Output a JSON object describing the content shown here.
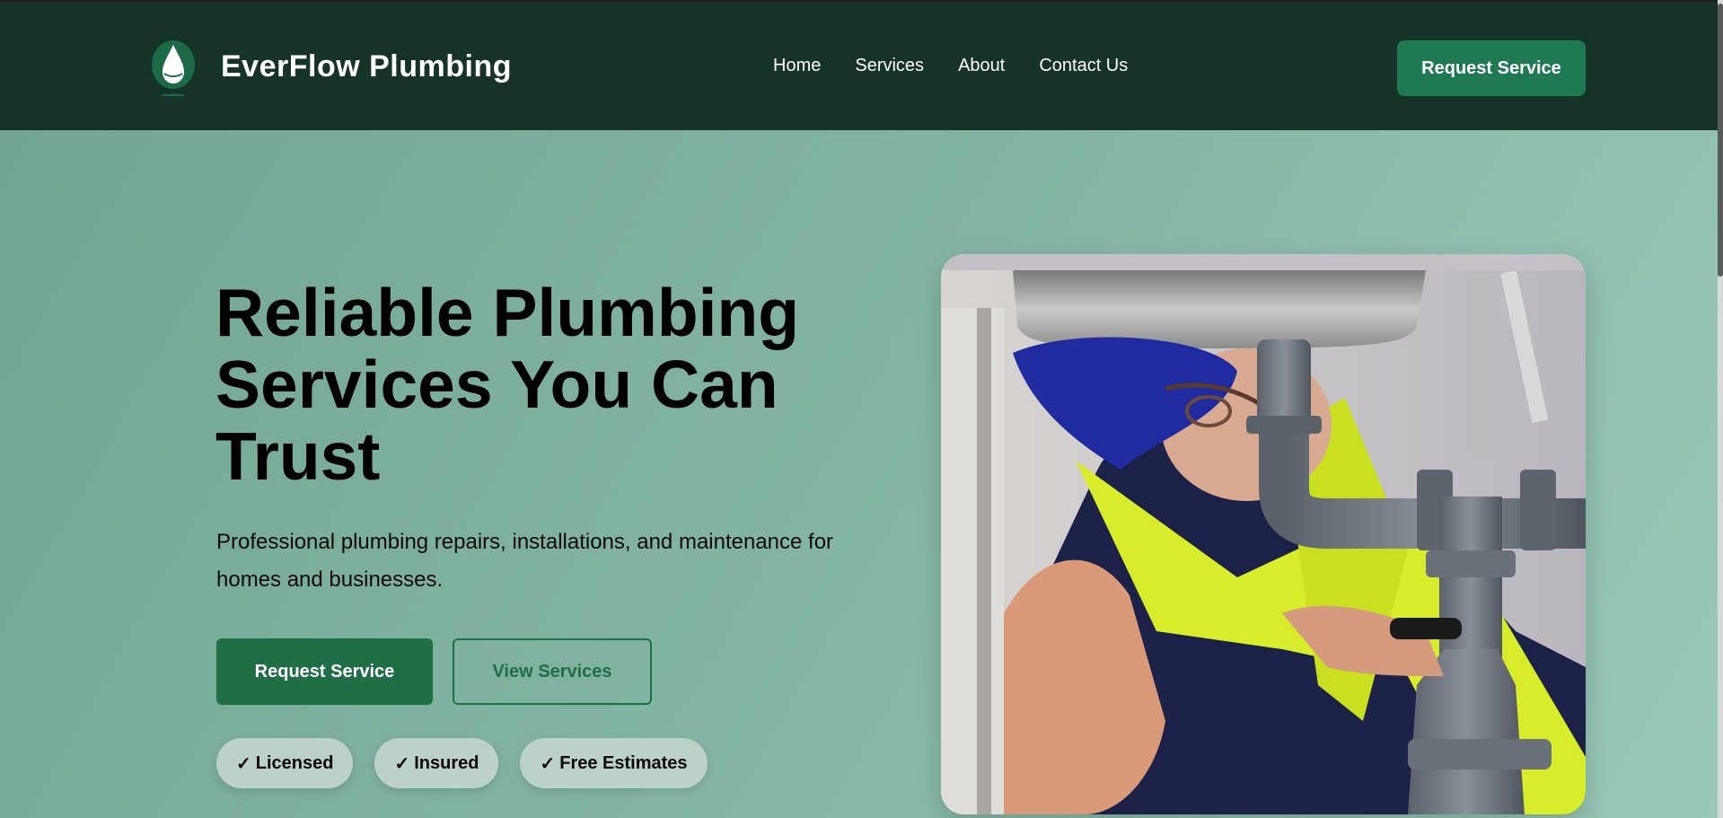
{
  "header": {
    "brand": "EverFlow Plumbing",
    "logo_icon": "water-drop-icon",
    "nav": [
      {
        "label": "Home"
      },
      {
        "label": "Services"
      },
      {
        "label": "About"
      },
      {
        "label": "Contact Us"
      }
    ],
    "cta_label": "Request Service"
  },
  "hero": {
    "title": "Reliable Plumbing Services You Can Trust",
    "subtitle": "Professional plumbing repairs, installations, and maintenance for homes and businesses.",
    "primary_cta": "Request Service",
    "secondary_cta": "View Services",
    "badges": [
      {
        "check": "✓",
        "label": "Licensed"
      },
      {
        "check": "✓",
        "label": "Insured"
      },
      {
        "check": "✓",
        "label": "Free Estimates"
      }
    ],
    "image_icon": "plumber-photo"
  },
  "colors": {
    "header_bg": "#163328",
    "accent": "#1f7a53",
    "hero_bg": "#79ad9b"
  }
}
